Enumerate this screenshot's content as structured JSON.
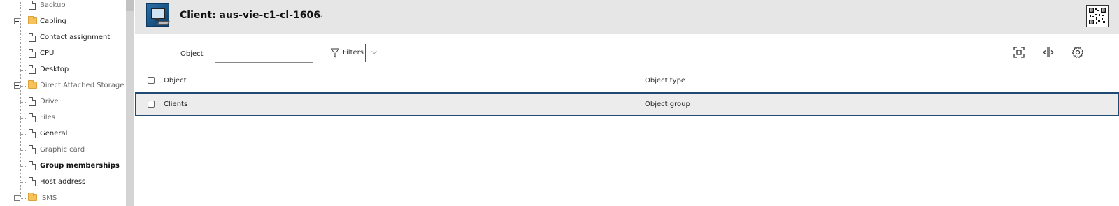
{
  "tree": {
    "items": [
      {
        "label": "Backup",
        "kind": "doc",
        "style": "muted"
      },
      {
        "label": "Cabling",
        "kind": "folder",
        "style": "dark"
      },
      {
        "label": "Contact assignment",
        "kind": "doc",
        "style": "dark"
      },
      {
        "label": "CPU",
        "kind": "doc",
        "style": "dark"
      },
      {
        "label": "Desktop",
        "kind": "doc",
        "style": "dark"
      },
      {
        "label": "Direct Attached Storage",
        "kind": "folder",
        "style": "muted"
      },
      {
        "label": "Drive",
        "kind": "doc",
        "style": "muted"
      },
      {
        "label": "Files",
        "kind": "doc",
        "style": "muted"
      },
      {
        "label": "General",
        "kind": "doc",
        "style": "dark"
      },
      {
        "label": "Graphic card",
        "kind": "doc",
        "style": "muted"
      },
      {
        "label": "Group memberships",
        "kind": "doc",
        "style": "bold"
      },
      {
        "label": "Host address",
        "kind": "doc",
        "style": "dark"
      },
      {
        "label": "ISMS",
        "kind": "folder",
        "style": "muted"
      }
    ]
  },
  "header": {
    "title": "Client: aus-vie-c1-cl-1606",
    "chevron": "⌵",
    "icons": {
      "client": "computer-icon",
      "qr": "qr-code-icon"
    }
  },
  "toolbar": {
    "object_label": "Object",
    "object_value": "",
    "filters_label": "Filters",
    "filters_chevron": "⌵",
    "icons": [
      "fullscreen-icon",
      "columns-icon",
      "settings-icon"
    ]
  },
  "table": {
    "columns": [
      "Object",
      "Object type"
    ],
    "rows": [
      {
        "object": "Clients",
        "object_type": "Object group",
        "selected": true
      }
    ]
  },
  "colors": {
    "header_bg": "#e6e6e6",
    "selected_row_border": "#1f4a73",
    "selected_row_bg": "#ececec",
    "folder": "#f7c25a"
  }
}
